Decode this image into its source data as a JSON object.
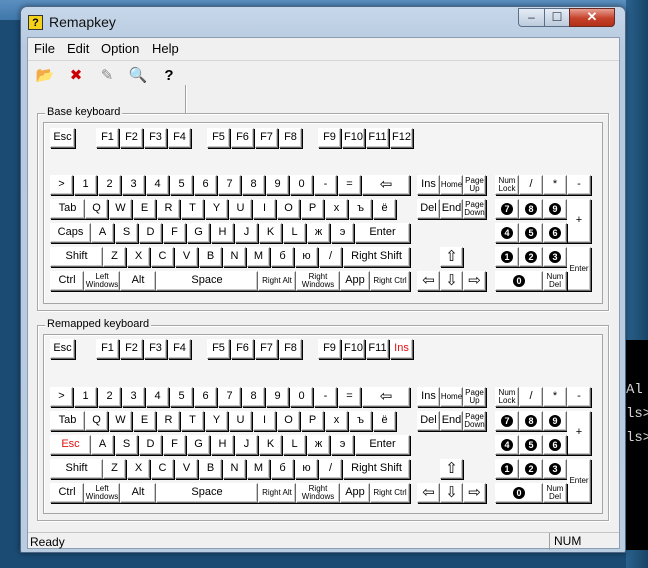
{
  "window": {
    "title": "Remapkey",
    "app_icon": "?",
    "minimize_icon": "–",
    "maximize_icon": "☐",
    "close_icon": "✕"
  },
  "menu": [
    "File",
    "Edit",
    "Option",
    "Help"
  ],
  "toolbar": [
    {
      "name": "open-icon",
      "glyph": "📂"
    },
    {
      "name": "delete-icon",
      "glyph": "✖"
    },
    {
      "name": "pen-icon",
      "glyph": "✎"
    },
    {
      "name": "find-icon",
      "glyph": "🔍"
    },
    {
      "name": "help-icon",
      "glyph": "?"
    }
  ],
  "base_keyboard": {
    "label": "Base keyboard",
    "fn_row": [
      "Esc",
      "F1",
      "F2",
      "F3",
      "F4",
      "F5",
      "F6",
      "F7",
      "F8",
      "F9",
      "F10",
      "F11",
      "F12"
    ],
    "row1": [
      ">",
      "1",
      "2",
      "3",
      "4",
      "5",
      "6",
      "7",
      "8",
      "9",
      "0",
      "-",
      "=",
      "⇦"
    ],
    "row2": [
      "Tab",
      "Q",
      "W",
      "E",
      "R",
      "T",
      "Y",
      "U",
      "I",
      "O",
      "P",
      "х",
      "ъ",
      "ё"
    ],
    "row3": [
      "Caps",
      "A",
      "S",
      "D",
      "F",
      "G",
      "H",
      "J",
      "K",
      "L",
      "ж",
      "э",
      "Enter"
    ],
    "row4": [
      "Shift",
      "Z",
      "X",
      "C",
      "V",
      "B",
      "N",
      "M",
      "б",
      "ю",
      "/",
      "Right Shift"
    ],
    "row5": [
      "Ctrl",
      "Left Windows",
      "Alt",
      "Space",
      "Right Alt",
      "Right Windows",
      "App",
      "Right Ctrl"
    ],
    "nav1": [
      "Ins",
      "Home",
      "Page Up"
    ],
    "nav2": [
      "Del",
      "End",
      "Page Down"
    ],
    "arrows": [
      "⇧",
      "⇦",
      "⇩",
      "⇨"
    ],
    "numpad": [
      "Num Lock",
      "/",
      "*",
      "-",
      "7",
      "8",
      "9",
      "+",
      "4",
      "5",
      "6",
      "1",
      "2",
      "3",
      "Enter",
      "0",
      "Num Del"
    ]
  },
  "remapped_keyboard": {
    "label": "Remapped keyboard",
    "fn_row": [
      "Esc",
      "F1",
      "F2",
      "F3",
      "F4",
      "F5",
      "F6",
      "F7",
      "F8",
      "F9",
      "F10",
      "F11",
      "Ins"
    ],
    "row1": [
      ">",
      "1",
      "2",
      "3",
      "4",
      "5",
      "6",
      "7",
      "8",
      "9",
      "0",
      "-",
      "=",
      "⇦"
    ],
    "row2": [
      "Tab",
      "Q",
      "W",
      "E",
      "R",
      "T",
      "Y",
      "U",
      "I",
      "O",
      "P",
      "х",
      "ъ",
      "ё"
    ],
    "row3": [
      "Esc",
      "A",
      "S",
      "D",
      "F",
      "G",
      "H",
      "J",
      "K",
      "L",
      "ж",
      "э",
      "Enter"
    ],
    "row4": [
      "Shift",
      "Z",
      "X",
      "C",
      "V",
      "B",
      "N",
      "M",
      "б",
      "ю",
      "/",
      "Right Shift"
    ],
    "row5": [
      "Ctrl",
      "Left Windows",
      "Alt",
      "Space",
      "Right Alt",
      "Right Windows",
      "App",
      "Right Ctrl"
    ],
    "nav1": [
      "Ins",
      "Home",
      "Page Up"
    ],
    "nav2": [
      "Del",
      "End",
      "Page Down"
    ],
    "arrows": [
      "⇧",
      "⇦",
      "⇩",
      "⇨"
    ],
    "numpad": [
      "Num Lock",
      "/",
      "*",
      "-",
      "7",
      "8",
      "9",
      "+",
      "4",
      "5",
      "6",
      "1",
      "2",
      "3",
      "Enter",
      "0",
      "Num Del"
    ],
    "highlight_color": "#e01010"
  },
  "status": {
    "text": "Ready",
    "num": "NUM"
  },
  "console": [
    "Al",
    "ls>",
    "ls>"
  ]
}
